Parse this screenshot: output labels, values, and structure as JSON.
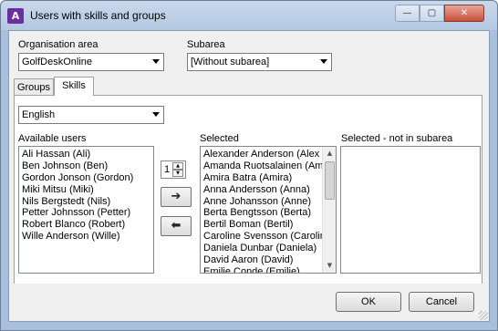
{
  "window": {
    "title": "Users with skills and groups",
    "icon": "app-logo-icon",
    "controls": {
      "minimize": "—",
      "maximize": "▢",
      "close": "✕"
    }
  },
  "org_area": {
    "label": "Organisation area",
    "value": "GolfDeskOnline"
  },
  "subarea": {
    "label": "Subarea",
    "value": "[Without subarea]"
  },
  "tabs": [
    {
      "label": "Groups",
      "active": false
    },
    {
      "label": "Skills",
      "active": true
    }
  ],
  "skill_select": {
    "value": "English"
  },
  "available_users": {
    "label": "Available users",
    "items": [
      "Ali Hassan (Ali)",
      "Ben Johnson (Ben)",
      "Gordon Jonson (Gordon)",
      "Miki Mitsu (Miki)",
      "Nils Bergstedt (Nils)",
      "Petter Johnsson (Petter)",
      "Robert Blanco (Robert)",
      "Wille Anderson (Wille)"
    ]
  },
  "level_spinner": {
    "value": "1"
  },
  "move_right": {
    "icon": "arrow-right-icon",
    "glyph": "➔"
  },
  "move_left": {
    "icon": "arrow-left-icon",
    "glyph": "⬅"
  },
  "selected": {
    "label": "Selected",
    "items": [
      "Alexander Anderson (Alex",
      "Amanda Ruotsalainen (Am",
      "Amira Batra (Amira)",
      "Anna Andersson (Anna)",
      "Anne Johansson (Anne)",
      "Berta Bengtsson (Berta)",
      "Bertil Boman (Bertil)",
      "Caroline Svensson (Carolin",
      "Daniela Dunbar (Daniela)",
      "David Aaron (David)",
      "Emilie Conde (Emilie)"
    ]
  },
  "selected_not_in_subarea": {
    "label": "Selected - not in subarea",
    "items": []
  },
  "buttons": {
    "ok": "OK",
    "cancel": "Cancel"
  },
  "colors": {
    "title_bar": "#b4c8e2",
    "close_button": "#c9503a",
    "app_icon": "#6b2fa0"
  }
}
